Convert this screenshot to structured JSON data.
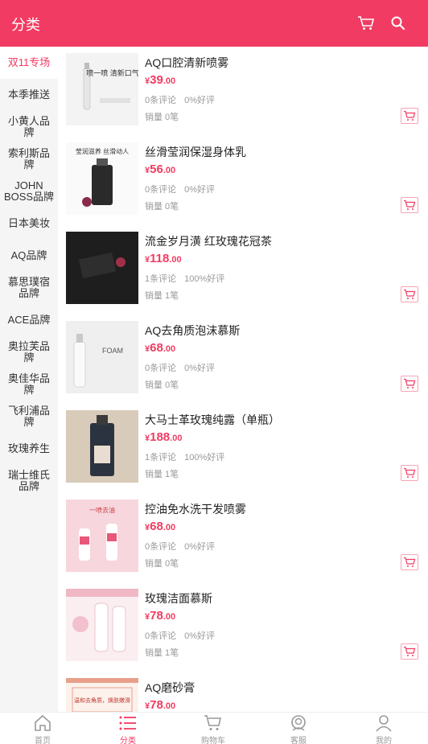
{
  "header": {
    "title": "分类",
    "cart_icon": "cart-icon",
    "search_icon": "search-icon",
    "color": "#f23b62"
  },
  "sidebar": {
    "items": [
      {
        "label": "双11专场",
        "active": true
      },
      {
        "label": "本季推送"
      },
      {
        "label": "小黄人品牌"
      },
      {
        "label": "索利斯品牌"
      },
      {
        "label": "JOHN BOSS品牌"
      },
      {
        "label": "日本美妆"
      },
      {
        "label": "AQ品牌"
      },
      {
        "label": "慕思璞宿品牌"
      },
      {
        "label": "ACE品牌"
      },
      {
        "label": "奥拉芙品牌"
      },
      {
        "label": "奥佳华品牌"
      },
      {
        "label": "飞利浦品牌"
      },
      {
        "label": "玫瑰养生"
      },
      {
        "label": "瑞士维氏品牌"
      }
    ]
  },
  "products": [
    {
      "name": "AQ口腔清新喷雾",
      "currency": "¥",
      "price_int": "39",
      "price_dec": ".00",
      "reviews": "0条评论",
      "rating": "0%好评",
      "sold": "销量 0笔",
      "image_text": "喷一喷 清新口气"
    },
    {
      "name": "丝滑莹润保湿身体乳",
      "currency": "¥",
      "price_int": "56",
      "price_dec": ".00",
      "reviews": "0条评论",
      "rating": "0%好评",
      "sold": "销量 0笔",
      "image_text": "莹润滋养  丝滑动人"
    },
    {
      "name": "流金岁月潢 红玫瑰花冠茶",
      "currency": "¥",
      "price_int": "118",
      "price_dec": ".00",
      "reviews": "1条评论",
      "rating": "100%好评",
      "sold": "销量 1笔",
      "image_text": ""
    },
    {
      "name": "AQ去角质泡沫慕斯",
      "currency": "¥",
      "price_int": "68",
      "price_dec": ".00",
      "reviews": "0条评论",
      "rating": "0%好评",
      "sold": "销量 0笔",
      "image_text": "FOAM"
    },
    {
      "name": "大马士革玫瑰纯露（单瓶）",
      "currency": "¥",
      "price_int": "188",
      "price_dec": ".00",
      "reviews": "1条评论",
      "rating": "100%好评",
      "sold": "销量 1笔",
      "image_text": ""
    },
    {
      "name": "控油免水洗干发喷雾",
      "currency": "¥",
      "price_int": "68",
      "price_dec": ".00",
      "reviews": "0条评论",
      "rating": "0%好评",
      "sold": "销量 0笔",
      "image_text": "一喷去油"
    },
    {
      "name": "玫瑰洁面慕斯",
      "currency": "¥",
      "price_int": "78",
      "price_dec": ".00",
      "reviews": "0条评论",
      "rating": "0%好评",
      "sold": "销量 1笔",
      "image_text": ""
    },
    {
      "name": "AQ磨砂膏",
      "currency": "¥",
      "price_int": "78",
      "price_dec": ".00",
      "reviews": "",
      "rating": "",
      "sold": "",
      "image_text": "温和去角质，焕肤嫩滑"
    }
  ],
  "tabbar": {
    "tabs": [
      {
        "label": "首页",
        "icon": "home-icon"
      },
      {
        "label": "分类",
        "icon": "category-icon",
        "active": true
      },
      {
        "label": "购物车",
        "icon": "cart-icon"
      },
      {
        "label": "客服",
        "icon": "service-icon"
      },
      {
        "label": "我的",
        "icon": "user-icon"
      }
    ]
  }
}
